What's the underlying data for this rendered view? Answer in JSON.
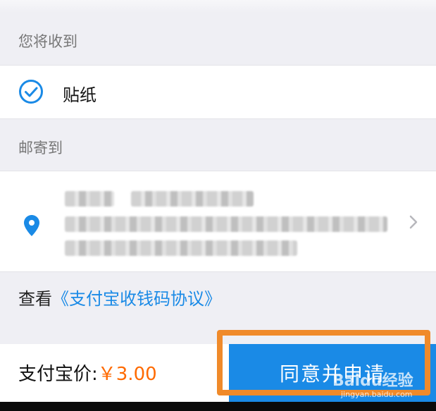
{
  "sections": {
    "receive_title": "您将收到",
    "ship_title": "邮寄到"
  },
  "receive": {
    "item_label": "贴纸",
    "checked": true
  },
  "agreement": {
    "prefix": "查看",
    "link_text": "《支付宝收钱码协议》"
  },
  "bottom_bar": {
    "price_label": "支付宝价:",
    "price_value": "￥3.00",
    "apply_button_label": "同意并申请"
  },
  "watermark": {
    "brand": "Baidu经验",
    "url": "jingyan.baidu.com"
  },
  "colors": {
    "accent": "#1a8ae6",
    "price": "#ff6a00",
    "highlight": "#f08a2a",
    "background": "#efeff4"
  }
}
